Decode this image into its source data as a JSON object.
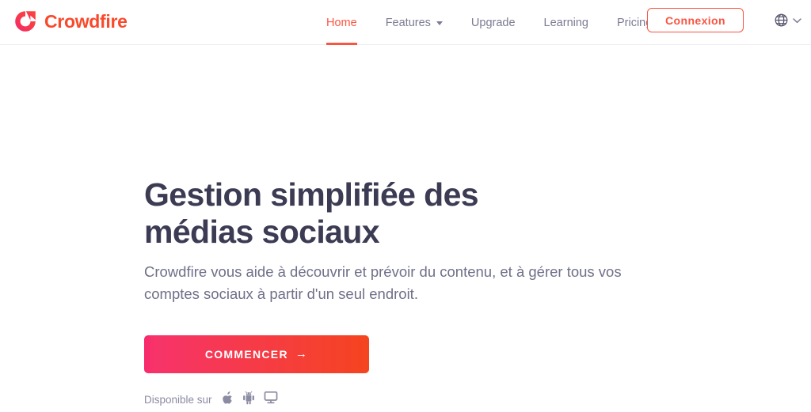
{
  "brand": {
    "name": "Crowdfire",
    "logo_icon": "crowdfire-logo-icon",
    "color": "#f9492b"
  },
  "header": {
    "nav": [
      {
        "label": "Home",
        "active": true,
        "has_caret": false
      },
      {
        "label": "Features",
        "active": false,
        "has_caret": true
      },
      {
        "label": "Upgrade",
        "active": false,
        "has_caret": false
      },
      {
        "label": "Learning",
        "active": false,
        "has_caret": false
      },
      {
        "label": "Pricing",
        "active": false,
        "has_caret": false
      }
    ],
    "login_label": "Connexion",
    "login_color": "#fb5441",
    "language_icon": "globe-icon",
    "language_caret_icon": "chevron-down-icon",
    "active_color": "#fb5441",
    "nav_color": "#7b7b93",
    "border_color": "#eceaee"
  },
  "hero": {
    "title": "Gestion simplifiée des médias sociaux",
    "subtitle": "Crowdfire vous aide à découvrir et prévoir du contenu, et à gérer tous vos comptes sociaux à partir d'un seul endroit.",
    "title_color": "#3c3b54",
    "subtitle_color": "#6f6f89",
    "cta_label": "COMMENCER",
    "cta_arrow": "→",
    "cta_gradient_from": "#f7286b",
    "cta_gradient_to": "#f5441f",
    "available_label": "Disponible sur",
    "platforms": [
      {
        "icon": "apple-icon",
        "name": "apple"
      },
      {
        "icon": "android-icon",
        "name": "android"
      },
      {
        "icon": "desktop-monitor-icon",
        "name": "desktop"
      }
    ]
  }
}
